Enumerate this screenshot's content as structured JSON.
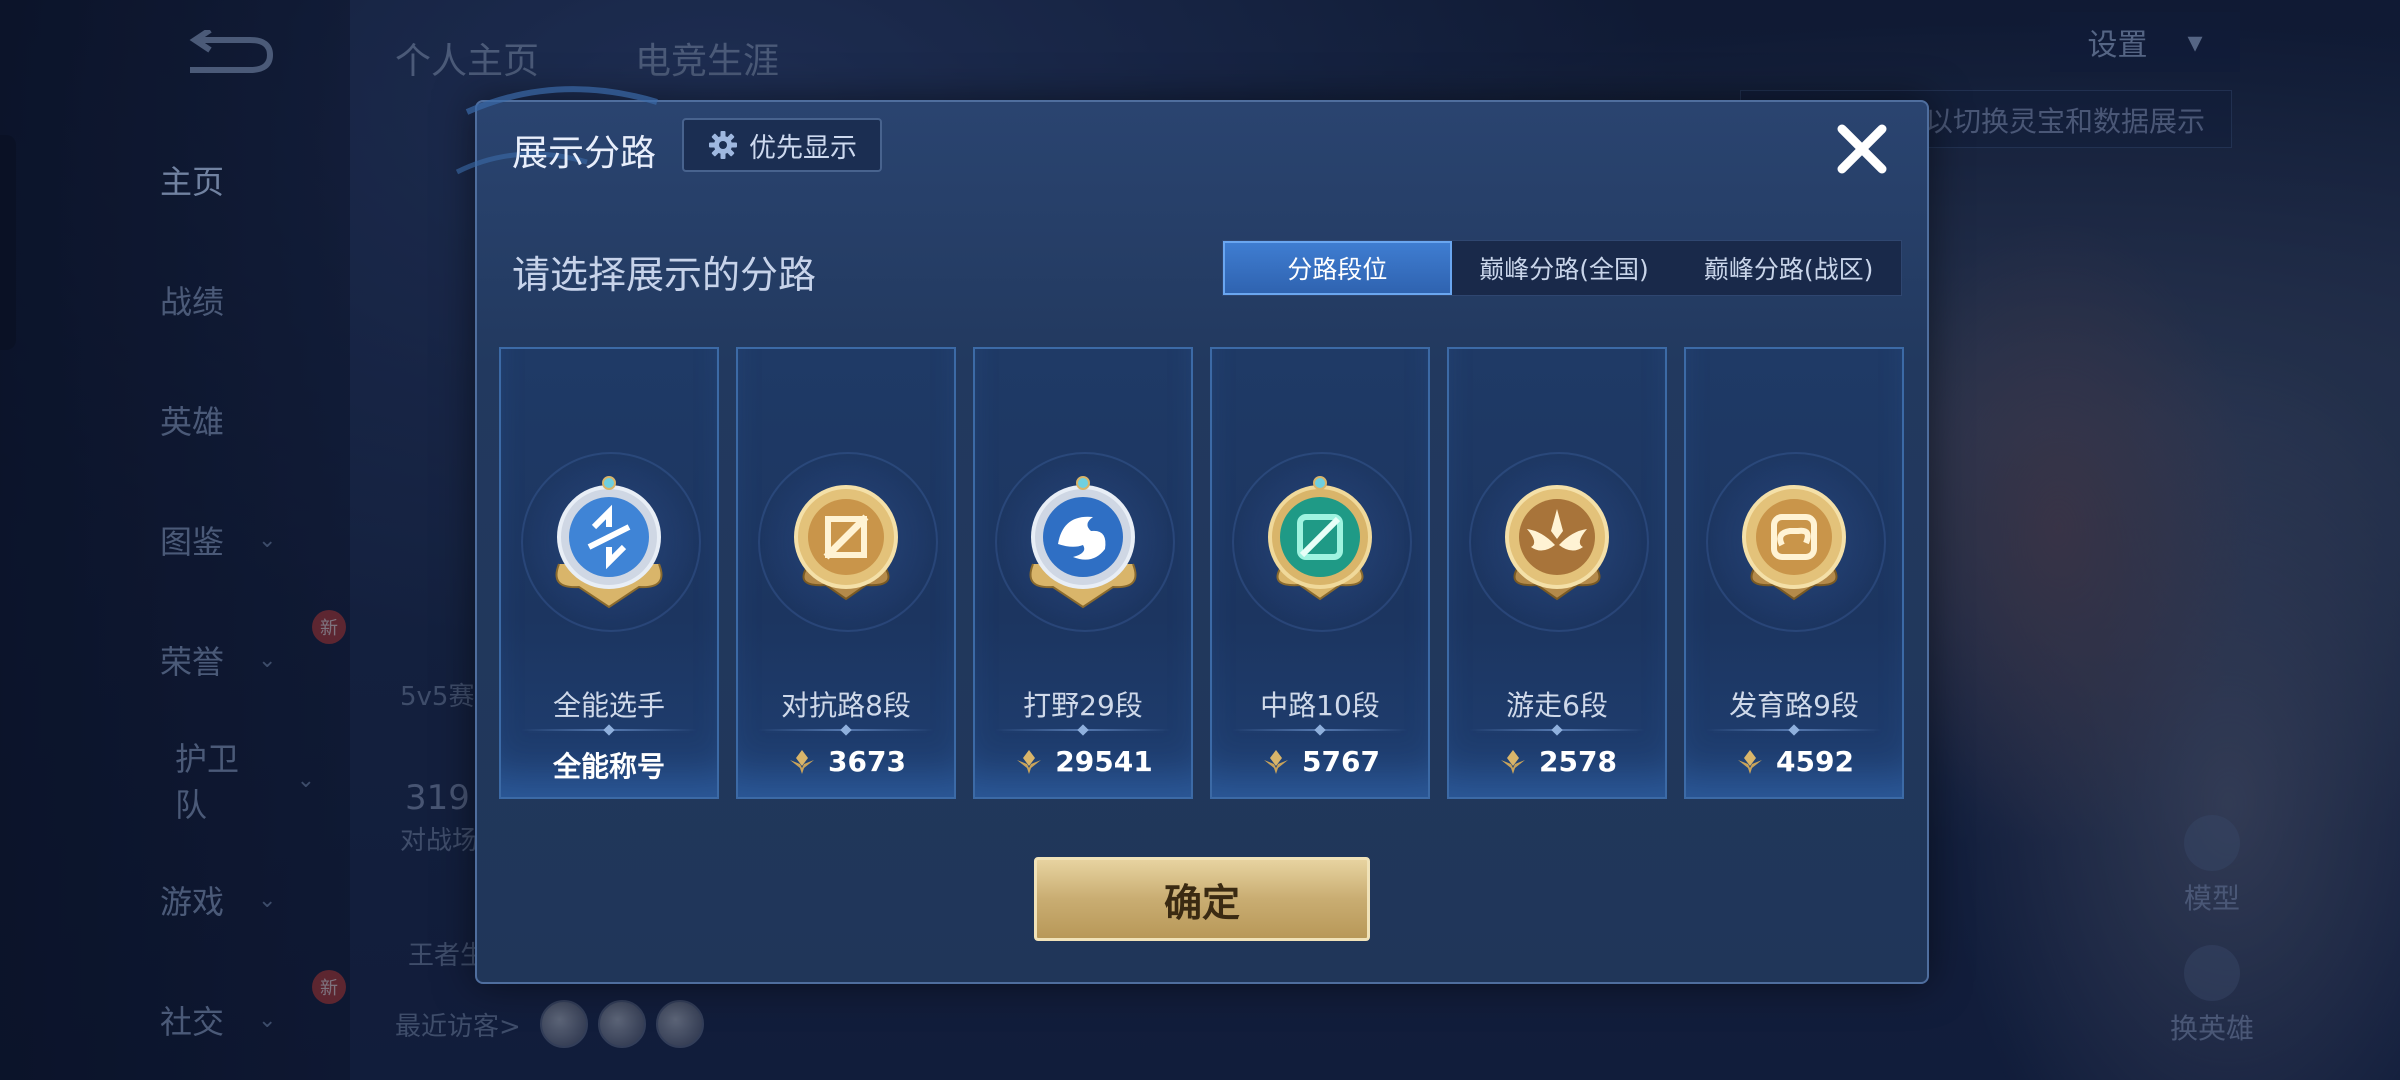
{
  "background": {
    "tabs": [
      "个人主页",
      "电竞生涯"
    ],
    "settings_label": "设置",
    "hint": "以切换灵宝和数据展示",
    "sidebar": [
      {
        "label": "主页",
        "chevron": false,
        "new": false
      },
      {
        "label": "战绩",
        "chevron": false,
        "new": false
      },
      {
        "label": "英雄",
        "chevron": false,
        "new": false
      },
      {
        "label": "图鉴",
        "chevron": true,
        "new": false
      },
      {
        "label": "荣誉",
        "chevron": true,
        "new": true
      },
      {
        "label": "护卫队",
        "chevron": true,
        "new": false
      },
      {
        "label": "游戏",
        "chevron": true,
        "new": false
      },
      {
        "label": "社交",
        "chevron": true,
        "new": true
      }
    ],
    "new_badge": "新",
    "profile_texts": [
      "5v5赛",
      "319",
      "对战场",
      "王者生"
    ],
    "recent_visitors": "最近访客>",
    "model_label": "模型",
    "switch_hero_label": "换英雄"
  },
  "modal": {
    "title": "展示分路",
    "priority_button": "优先显示",
    "prompt": "请选择展示的分路",
    "tabs": [
      {
        "label": "分路段位",
        "active": true
      },
      {
        "label": "巅峰分路(全国)",
        "active": false
      },
      {
        "label": "巅峰分路(战区)",
        "active": false
      }
    ],
    "lanes": [
      {
        "label": "全能选手",
        "value": "全能称号",
        "icon": "all-round-emblem-icon",
        "theme": "blue",
        "show_points_icon": false
      },
      {
        "label": "对抗路8段",
        "value": "3673",
        "icon": "clash-lane-emblem-icon",
        "theme": "gold",
        "show_points_icon": true
      },
      {
        "label": "打野29段",
        "value": "29541",
        "icon": "jungle-emblem-icon",
        "theme": "blue",
        "show_points_icon": true
      },
      {
        "label": "中路10段",
        "value": "5767",
        "icon": "mid-lane-emblem-icon",
        "theme": "green",
        "show_points_icon": true
      },
      {
        "label": "游走6段",
        "value": "2578",
        "icon": "roam-emblem-icon",
        "theme": "gold",
        "show_points_icon": true
      },
      {
        "label": "发育路9段",
        "value": "4592",
        "icon": "farm-lane-emblem-icon",
        "theme": "gold",
        "show_points_icon": true
      }
    ],
    "confirm": "确定"
  },
  "colors": {
    "gold": "#d9b56a",
    "blue": "#3f84d6",
    "green": "#34c6a8",
    "active_tab": "#3f7dd1",
    "confirm_bg": "#c9ad72"
  }
}
